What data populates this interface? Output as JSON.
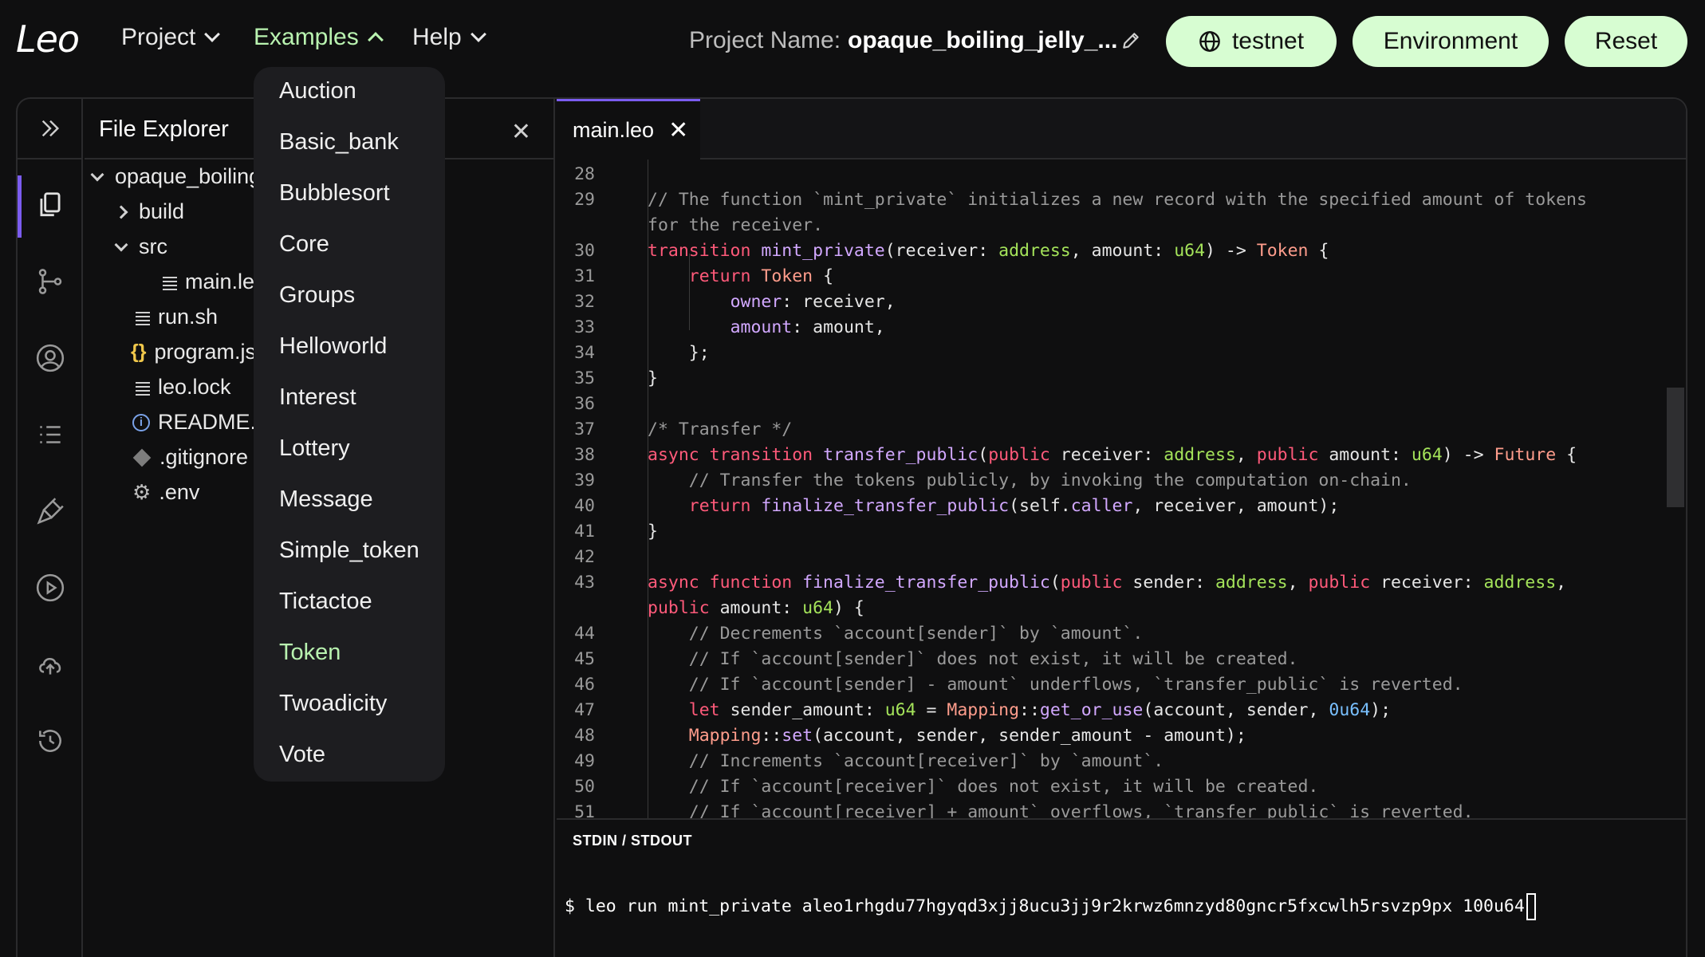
{
  "logo": "Leo",
  "menu": {
    "project": "Project",
    "examples": "Examples",
    "help": "Help"
  },
  "project": {
    "label": "Project Name:",
    "name": "opaque_boiling_jelly_..."
  },
  "buttons": {
    "network": "testnet",
    "environment": "Environment",
    "reset": "Reset"
  },
  "explorer": {
    "title": "File Explorer",
    "items": [
      {
        "label": "opaque_boiling",
        "icon": "chevron-down-icon"
      },
      {
        "label": "build",
        "icon": "chevron-right-icon"
      },
      {
        "label": "src",
        "icon": "chevron-down-icon"
      },
      {
        "label": "main.leo",
        "icon": "lines-icon"
      },
      {
        "label": "run.sh",
        "icon": "lines-icon"
      },
      {
        "label": "program.jso",
        "icon": "braces-icon"
      },
      {
        "label": "leo.lock",
        "icon": "lines-icon"
      },
      {
        "label": "README.m",
        "icon": "info-icon"
      },
      {
        "label": ".gitignore",
        "icon": "diamond-icon"
      },
      {
        "label": ".env",
        "icon": "gear-icon"
      }
    ]
  },
  "examples_menu": {
    "items": [
      "Auction",
      "Basic_bank",
      "Bubblesort",
      "Core",
      "Groups",
      "Helloworld",
      "Interest",
      "Lottery",
      "Message",
      "Simple_token",
      "Tictactoe",
      "Token",
      "Twoadicity",
      "Vote"
    ],
    "selected": "Token"
  },
  "editor": {
    "tab": "main.leo",
    "line_numbers": [
      "28",
      "29",
      "",
      "30",
      "31",
      "32",
      "33",
      "34",
      "35",
      "36",
      "37",
      "38",
      "39",
      "40",
      "41",
      "42",
      "43",
      "",
      "44",
      "45",
      "46",
      "47",
      "48",
      "49",
      "50",
      "51"
    ]
  },
  "terminal": {
    "title": "STDIN / STDOUT",
    "command": "$ leo run mint_private aleo1rhgdu77hgyqd3xjj8ucu3jj9r2krwz6mnzyd80gncr5fxcwlh5rsvzp9px 100u64"
  },
  "colors": {
    "accent": "#7b5cf0",
    "pill_bg": "#d7fdd2",
    "selected_menu": "#b9f3b0"
  }
}
